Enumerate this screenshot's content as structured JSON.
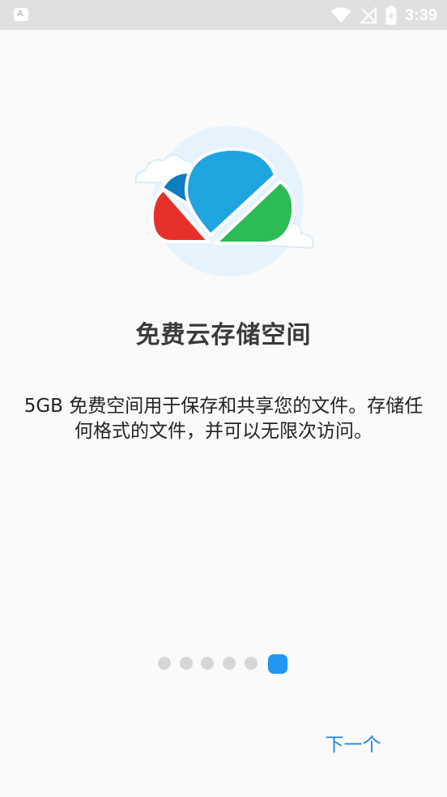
{
  "status_bar": {
    "notification_icon": "A",
    "time": "3:39",
    "icons": [
      "wifi-icon",
      "no-signal-icon",
      "battery-charging-icon"
    ]
  },
  "onboarding": {
    "illustration": "cloud-storage-icon",
    "title": "免费云存储空间",
    "description": "5GB 免费空间用于保存和共享您的文件。存储任何格式的文件，并可以无限次访问。",
    "page_count": 6,
    "current_page": 6
  },
  "footer": {
    "next_label": "下一个"
  },
  "colors": {
    "accent": "#2196f3",
    "cloud_blue": "#1ea5e0",
    "cloud_dark_blue": "#0f7dbf",
    "cloud_red": "#e8302b",
    "cloud_green": "#2dbb55",
    "circle_bg": "#e6f3fc"
  }
}
